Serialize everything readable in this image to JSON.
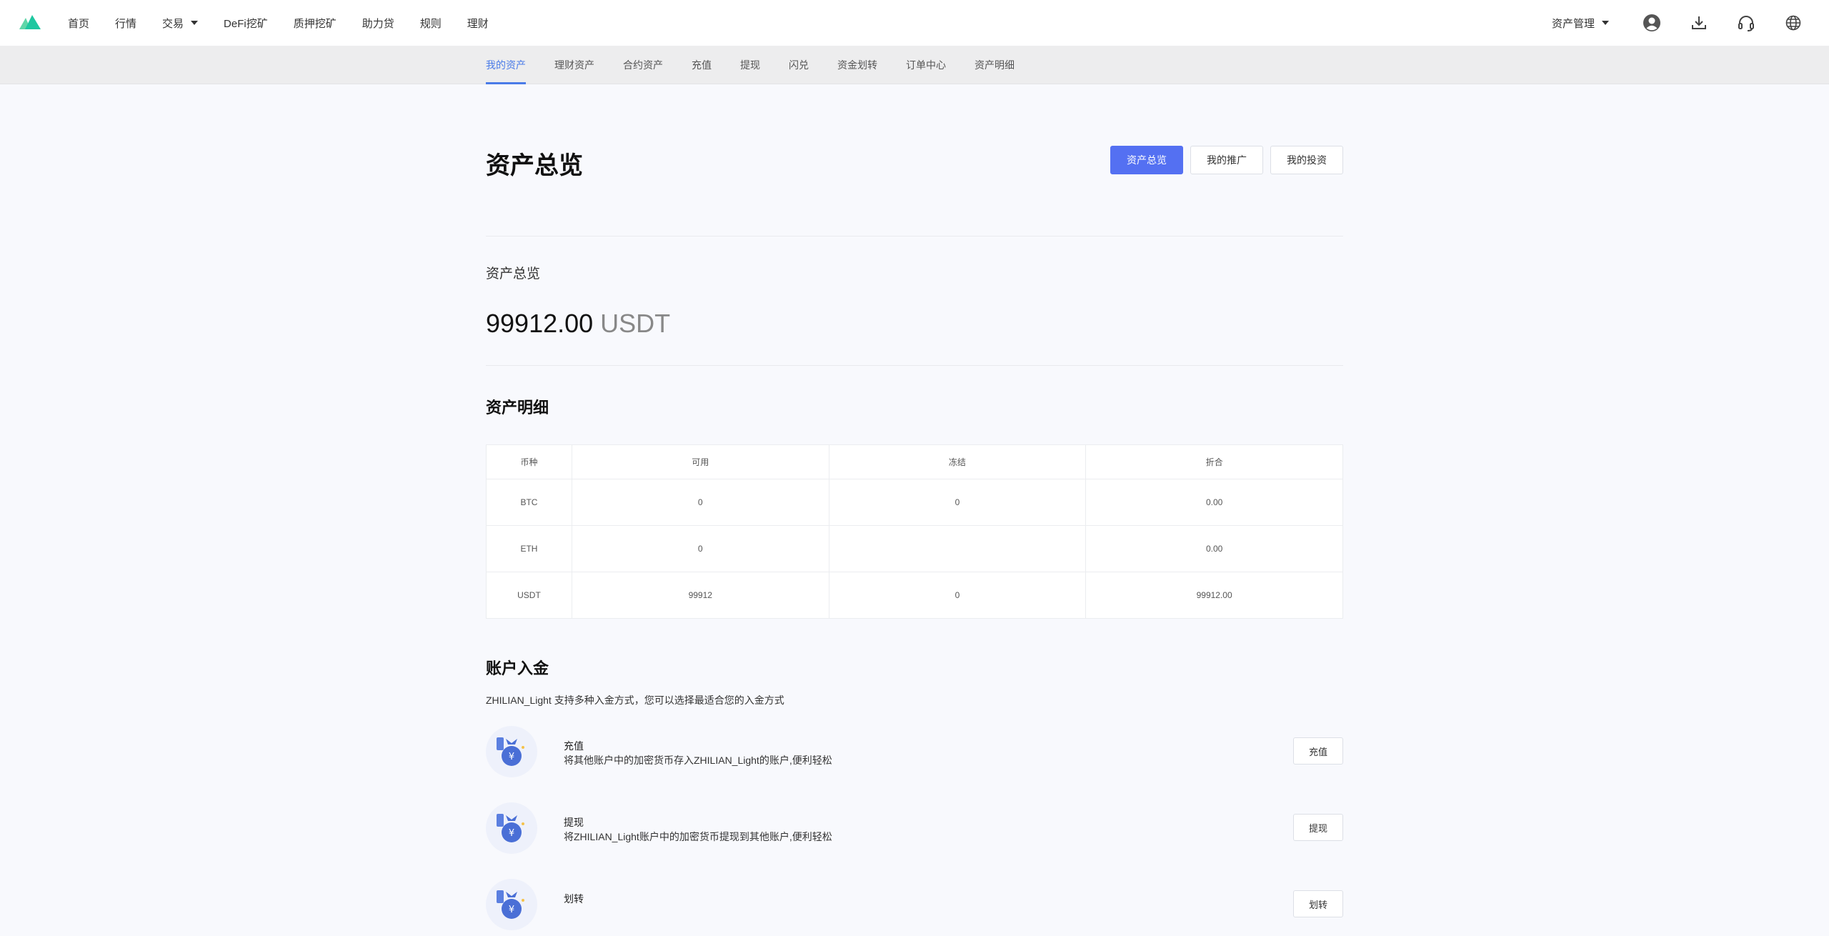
{
  "topnav": {
    "items": [
      {
        "label": "首页"
      },
      {
        "label": "行情"
      },
      {
        "label": "交易",
        "dropdown": true
      },
      {
        "label": "DeFi挖矿"
      },
      {
        "label": "质押挖矿"
      },
      {
        "label": "助力贷"
      },
      {
        "label": "规则"
      },
      {
        "label": "理财"
      }
    ],
    "asset_mgmt": "资产管理",
    "icons": [
      "user-icon",
      "download-icon",
      "headset-icon",
      "globe-icon"
    ]
  },
  "subnav": {
    "items": [
      "我的资产",
      "理财资产",
      "合约资产",
      "充值",
      "提现",
      "闪兑",
      "资金划转",
      "订单中心",
      "资产明细"
    ],
    "active": 0
  },
  "header": {
    "title": "资产总览",
    "buttons": [
      "资产总览",
      "我的推广",
      "我的投资"
    ]
  },
  "overview": {
    "label": "资产总览",
    "amount": "99912.00",
    "unit": "USDT"
  },
  "details": {
    "title": "资产明细",
    "columns": [
      "币种",
      "可用",
      "冻结",
      "折合"
    ],
    "rows": [
      [
        "BTC",
        "0",
        "0",
        "0.00"
      ],
      [
        "ETH",
        "0",
        "",
        "0.00"
      ],
      [
        "USDT",
        "99912",
        "0",
        "99912.00"
      ]
    ]
  },
  "deposit": {
    "title": "账户入金",
    "desc": "ZHILIAN_Light 支持多种入金方式，您可以选择最适合您的入金方式",
    "items": [
      {
        "title": "充值",
        "text": "将其他账户中的加密货币存入ZHILIAN_Light的账户,便利轻松",
        "button": "充值"
      },
      {
        "title": "提现",
        "text": "将ZHILIAN_Light账户中的加密货币提现到其他账户,便利轻松",
        "button": "提现"
      },
      {
        "title": "划转",
        "text": "",
        "button": "划转"
      }
    ]
  },
  "colors": {
    "accent": "#4a7be8",
    "primary_button": "#5470f2",
    "logo_green": "#1fc7a0"
  }
}
